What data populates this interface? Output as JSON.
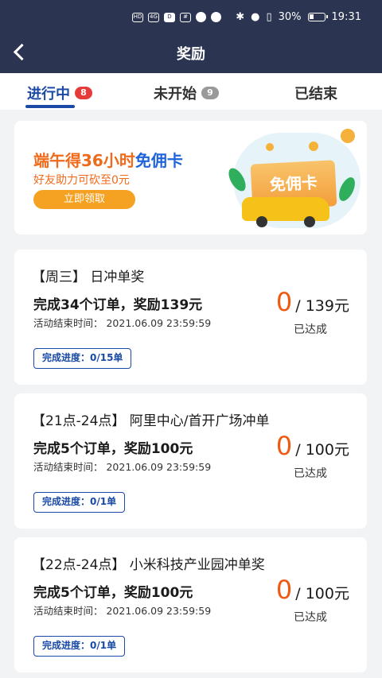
{
  "status": {
    "battery": "30%",
    "time": "19:31",
    "battery_level": 0.3
  },
  "header": {
    "title": "奖励"
  },
  "tabs": [
    {
      "label": "进行中",
      "badge": "8",
      "active": true
    },
    {
      "label": "未开始",
      "badge": "9",
      "active": false
    },
    {
      "label": "已结束",
      "badge": "",
      "active": false
    }
  ],
  "banner": {
    "title_orange": "端午得36小时",
    "title_blue": "免佣卡",
    "subtitle": "好友助力可砍至0元",
    "button": "立即领取",
    "card_text": "免佣卡"
  },
  "rewards": [
    {
      "tag": "【周三】 日冲单奖",
      "desc": "完成34个订单，奖励139元",
      "time": "活动结束时间：  2021.06.09 23:59:59",
      "progress": "完成进度：0/15单",
      "current": "0",
      "target": "/ 139元",
      "status": "已达成"
    },
    {
      "tag": "【21点-24点】 阿里中心/首开广场冲单",
      "desc": "完成5个订单，奖励100元",
      "time": "活动结束时间：  2021.06.09 23:59:59",
      "progress": "完成进度：0/1单",
      "current": "0",
      "target": "/ 100元",
      "status": "已达成"
    },
    {
      "tag": "【22点-24点】 小米科技产业园冲单奖",
      "desc": "完成5个订单，奖励100元",
      "time": "活动结束时间：  2021.06.09 23:59:59",
      "progress": "完成进度：0/1单",
      "current": "0",
      "target": "/ 100元",
      "status": "已达成"
    }
  ]
}
